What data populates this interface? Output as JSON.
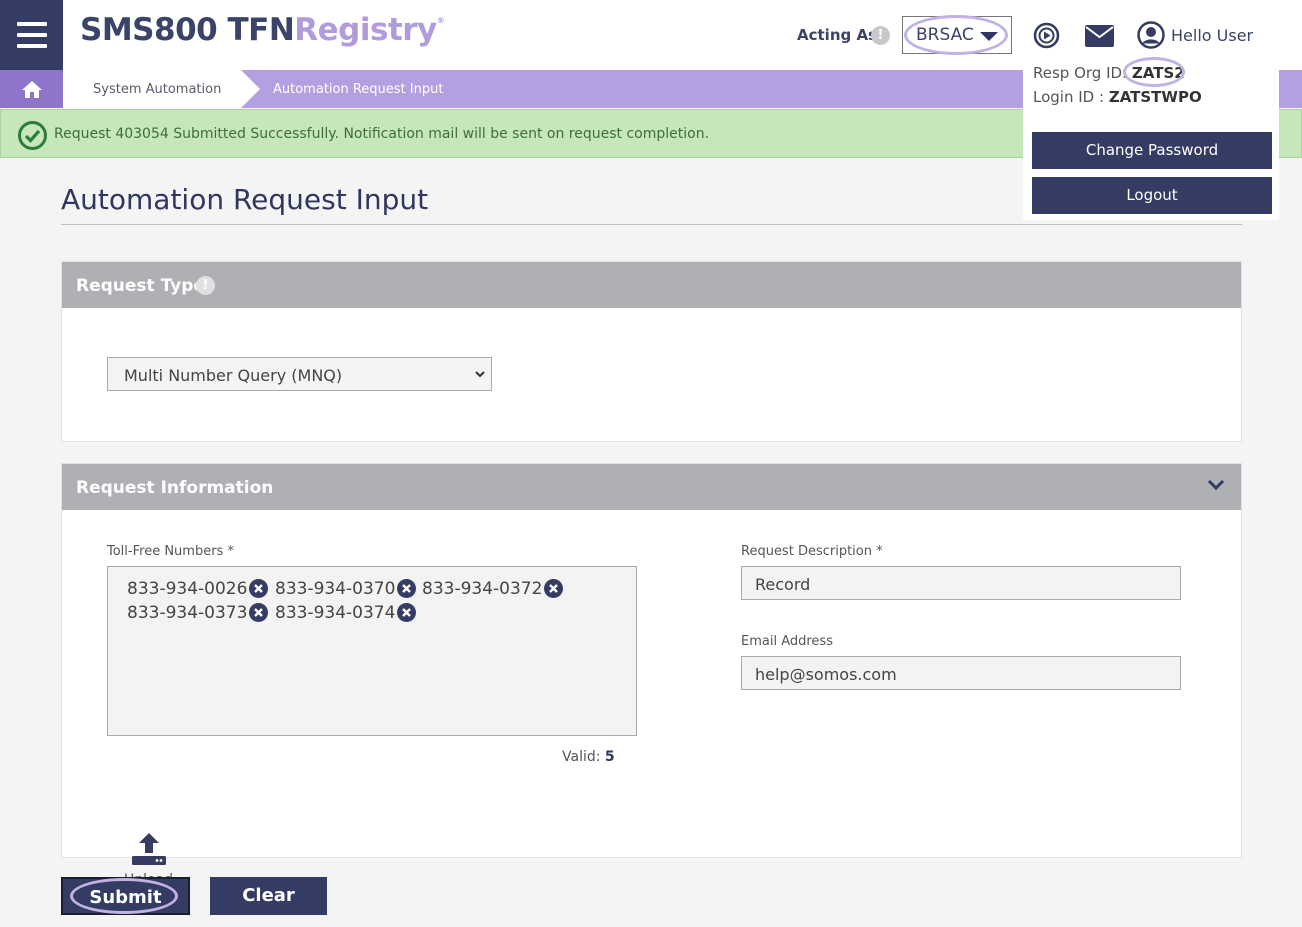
{
  "header": {
    "logo_part1": "SMS800 TFN",
    "logo_part2": "Registry",
    "logo_mark": "®",
    "acting_as_label": "Acting As",
    "info_glyph": "!",
    "resp_org_selected": "BRSAC",
    "greeting": "Hello User",
    "icons": [
      "menu-icon",
      "play-circle-icon",
      "mail-icon",
      "user-circle-icon",
      "home-icon"
    ]
  },
  "breadcrumb": {
    "items": [
      "System Automation",
      "Automation Request Input"
    ]
  },
  "notification": {
    "text": "Request 403054 Submitted Successfully. Notification mail will be sent on request completion."
  },
  "user_menu": {
    "resp_org_label": "Resp Org ID:",
    "resp_org_value": "ZATS2",
    "login_label": "Login ID :",
    "login_value": "ZATSTWPO",
    "change_password": "Change Password",
    "logout": "Logout"
  },
  "page": {
    "title": "Automation Request Input"
  },
  "request_type": {
    "title": "Request Type",
    "selected": "Multi Number Query (MNQ)"
  },
  "request_info": {
    "title": "Request Information",
    "tfn_label": "Toll-Free Numbers *",
    "tfns": [
      "833-934-0026",
      "833-934-0370",
      "833-934-0372",
      "833-934-0373",
      "833-934-0374"
    ],
    "valid_label": "Valid:",
    "valid_count": "5",
    "description_label": "Request Description *",
    "description_value": "Record",
    "email_label": "Email Address",
    "email_value": "help@somos.com",
    "upload_label": "Upload"
  },
  "actions": {
    "submit": "Submit",
    "clear": "Clear"
  },
  "colors": {
    "navy": "#343c63",
    "purple": "#b49fe0",
    "success_bg": "#c7e6bb",
    "panel_header": "#aeb0b3",
    "highlight_ring": "#c1b1e6"
  }
}
